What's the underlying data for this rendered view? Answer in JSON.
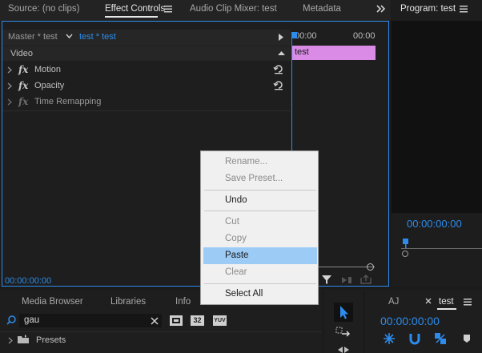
{
  "top_tabs": {
    "source": "Source: (no clips)",
    "effect_controls": "Effect Controls",
    "audio_mixer": "Audio Clip Mixer: test",
    "metadata": "Metadata"
  },
  "program": {
    "title": "Program: test",
    "timecode": "00:00:00:00"
  },
  "effect_controls": {
    "master_label": "Master * test",
    "sequence_label": "test * test",
    "section": "Video",
    "effects": [
      "Motion",
      "Opacity",
      "Time Remapping"
    ],
    "fx_glyph": "fx",
    "timecode": "00:00:00:00",
    "ruler_start": "00:00",
    "ruler_end": "00:00",
    "clip_name": "test"
  },
  "context_menu": {
    "items": [
      {
        "label": "Rename...",
        "enabled": false
      },
      {
        "label": "Save Preset...",
        "enabled": false
      },
      {
        "label": "Undo",
        "enabled": true
      },
      {
        "label": "Cut",
        "enabled": false
      },
      {
        "label": "Copy",
        "enabled": false
      },
      {
        "label": "Paste",
        "enabled": true,
        "highlighted": true
      },
      {
        "label": "Clear",
        "enabled": false
      },
      {
        "label": "Select All",
        "enabled": true
      }
    ],
    "highlight_color": "#9ccbf6"
  },
  "bottom_tabs": {
    "media_browser": "Media Browser",
    "libraries": "Libraries",
    "info": "Info"
  },
  "effects_panel": {
    "search_value": "gau",
    "folder": "Presets",
    "badge_32": "32",
    "badge_yuv": "YUV"
  },
  "timeline": {
    "tab_aj": "AJ",
    "tab_test": "test",
    "timecode": "00:00:00:00"
  },
  "colors": {
    "accent_blue": "#2d8ceb",
    "clip_pink": "#d98be6",
    "panel_border": "#2d8ceb"
  }
}
